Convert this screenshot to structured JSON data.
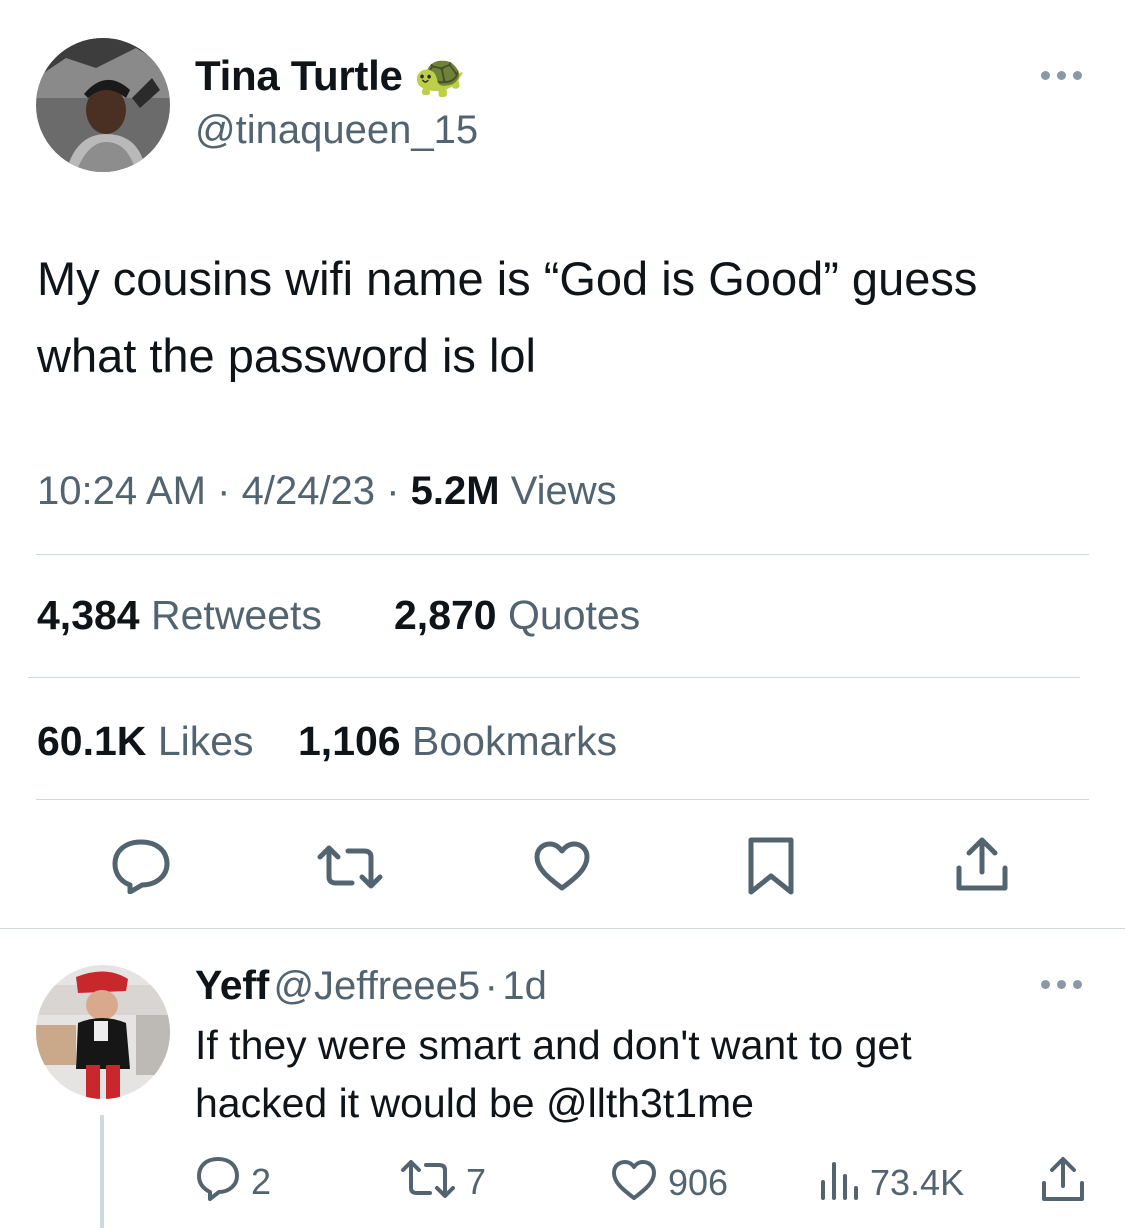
{
  "tweet": {
    "author_name": "Tina Turtle",
    "author_emoji": "🐢",
    "author_handle": "@tinaqueen_15",
    "text_line1": "My cousins wifi name is “God is Good” guess",
    "text_line2": "what the password is lol",
    "time": "10:24 AM",
    "sep1": "·",
    "date": "4/24/23",
    "sep2": "·",
    "views_count": "5.2M",
    "views_label": "Views",
    "retweets_count": "4,384",
    "retweets_label": "Retweets",
    "quotes_count": "2,870",
    "quotes_label": "Quotes",
    "likes_count": "60.1K",
    "likes_label": "Likes",
    "bookmarks_count": "1,106",
    "bookmarks_label": "Bookmarks"
  },
  "reply": {
    "author_name": "Yeff",
    "author_handle": "@Jeffreee5",
    "sep": "·",
    "age": "1d",
    "text_line1": "If they were smart and don't want to get",
    "text_line2": "hacked it would be @llth3t1me",
    "replies": "2",
    "retweets": "7",
    "likes": "906",
    "views": "73.4K"
  },
  "icons": {
    "actions": [
      "reply-icon",
      "retweet-icon",
      "like-icon",
      "bookmark-icon",
      "share-icon"
    ],
    "reply_actions": [
      "reply-icon",
      "retweet-icon",
      "like-icon",
      "views-icon",
      "share-icon"
    ],
    "more": "more-icon"
  },
  "colors": {
    "text": "#0f1419",
    "secondary": "#536471",
    "divider": "#cfd9de"
  }
}
